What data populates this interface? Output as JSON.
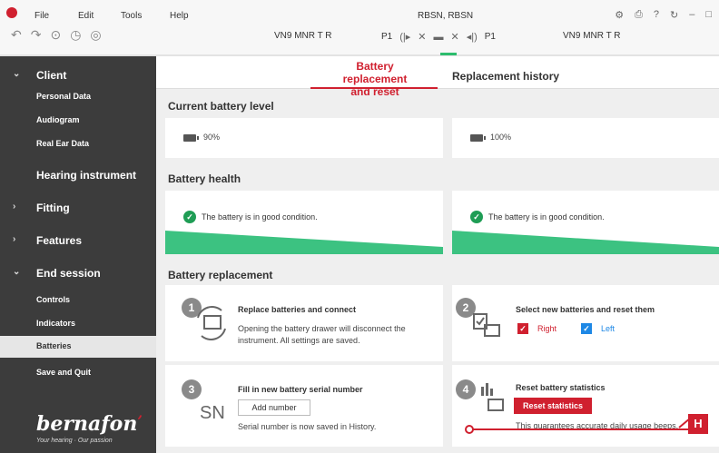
{
  "menu": {
    "file": "File",
    "edit": "Edit",
    "tools": "Tools",
    "help": "Help"
  },
  "window_title": "RBSN, RBSN",
  "window_controls": [
    "gear-icon",
    "print-icon",
    "help-icon",
    "refresh-icon",
    "minimize-icon",
    "maximize-icon"
  ],
  "toolbar": {
    "device_left": "VN9 MNR T R",
    "device_right": "VN9 MNR T R",
    "program_left": "P1",
    "program_right": "P1"
  },
  "sidebar": {
    "client": "Client",
    "personal_data": "Personal Data",
    "audiogram": "Audiogram",
    "real_ear_data": "Real Ear Data",
    "hearing_instrument": "Hearing instrument",
    "fitting": "Fitting",
    "features": "Features",
    "end_session": "End session",
    "controls": "Controls",
    "indicators": "Indicators",
    "batteries": "Batteries",
    "save_and_quit": "Save and Quit",
    "brand": "bernafon",
    "tagline": "Your hearing · Our passion"
  },
  "tabs": {
    "active_line1": "Battery replacement",
    "active_line2": "and reset",
    "other": "Replacement history"
  },
  "current_battery": {
    "title": "Current battery level",
    "left_level": "90%",
    "right_level": "100%",
    "left_fraction": 0.9,
    "right_fraction": 1.0
  },
  "battery_health": {
    "title": "Battery health",
    "left_status": "The battery is in good condition.",
    "right_status": "The battery is in good condition."
  },
  "replacement": {
    "title": "Battery replacement",
    "step1": {
      "num": "1",
      "title": "Replace batteries and connect",
      "desc1": "Opening the battery drawer will disconnect the",
      "desc2": "instrument. All settings are saved."
    },
    "step2": {
      "num": "2",
      "title": "Select new batteries and reset them",
      "right": "Right",
      "left": "Left"
    },
    "step3": {
      "num": "3",
      "title": "Fill in new battery serial number",
      "sn": "SN",
      "button": "Add number",
      "desc": "Serial number is now saved in History."
    },
    "step4": {
      "num": "4",
      "title": "Reset battery statistics",
      "button": "Reset statistics",
      "desc": "This guarantees accurate daily usage beeps."
    }
  },
  "annotation": {
    "label": "H"
  },
  "colors": {
    "accent": "#d0202f",
    "green": "#2dbd6e",
    "sidebar_bg": "#3c3c3c",
    "left_blue": "#1e88e5"
  }
}
